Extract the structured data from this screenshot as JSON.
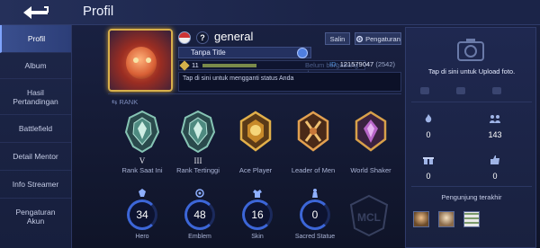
{
  "header": {
    "back_label": "back",
    "title": "Profil"
  },
  "sidebar": {
    "items": [
      {
        "label": "Profil",
        "active": true
      },
      {
        "label": "Album",
        "active": false
      },
      {
        "label": "Hasil Pertandingan",
        "active": false
      },
      {
        "label": "Battlefield",
        "active": false
      },
      {
        "label": "Detail Mentor",
        "active": false
      },
      {
        "label": "Info Streamer",
        "active": false
      },
      {
        "label": "Pengaturan Akun",
        "active": false
      }
    ]
  },
  "profile": {
    "help_glyph": "?",
    "name": "general",
    "copy_label": "Salin",
    "settings_label": "Pengaturan",
    "title": "Tanpa Title",
    "level": "11",
    "team_status": "Belum bergabung da",
    "id_label": "ID:",
    "id_value": "121579047",
    "id_server": "(2542)",
    "status_placeholder": "Tap di sini untuk mengganti status Anda"
  },
  "rank": {
    "header": "RANK",
    "items": [
      {
        "tier": "V",
        "label": "Rank Saat Ini",
        "color": "#6aa89c"
      },
      {
        "tier": "III",
        "label": "Rank Tertinggi",
        "color": "#6aa89c"
      },
      {
        "tier": "",
        "label": "Ace Player",
        "color": "#d4a03a"
      },
      {
        "tier": "",
        "label": "Leader of Men",
        "color": "#c98a3a"
      },
      {
        "tier": "",
        "label": "World Shaker",
        "color": "#b866c8"
      }
    ]
  },
  "stats": {
    "items": [
      {
        "value": "34",
        "label": "Hero"
      },
      {
        "value": "48",
        "label": "Emblem"
      },
      {
        "value": "16",
        "label": "Skin"
      },
      {
        "value": "0",
        "label": "Sacred Statue"
      }
    ],
    "logo_text": "MCL"
  },
  "right_panel": {
    "upload_text": "Tap di sini untuk Upload foto.",
    "stats": [
      {
        "icon": "fire-icon",
        "value": "0"
      },
      {
        "icon": "group-icon",
        "value": "143"
      },
      {
        "icon": "gift-icon",
        "value": "0"
      },
      {
        "icon": "thumbs-up-icon",
        "value": "0"
      }
    ],
    "recent_visitors_label": "Pengunjung terakhir"
  },
  "colors": {
    "accent_blue": "#3c66d8",
    "gold": "#d4b04a",
    "id_blue": "#4f8fd8"
  }
}
